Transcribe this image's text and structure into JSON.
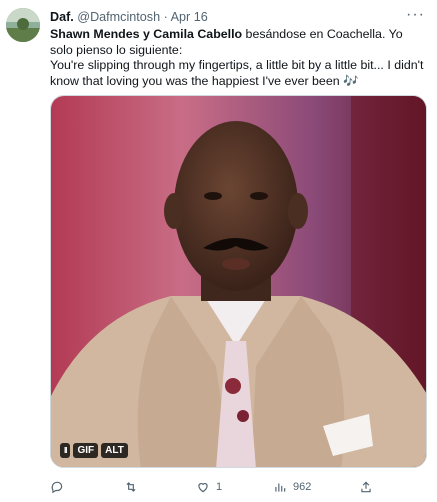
{
  "tweet": {
    "author_name": "Daf.",
    "handle": "@Dafmcintosh",
    "separator": "·",
    "date": "Apr 16",
    "more_label": "···",
    "text_bold": "Shawn Mendes y Camila Cabello",
    "text_line1_rest": " besándose en Coachella. Yo solo pienso lo siguiente:",
    "text_line2": "You're slipping through my fingertips, a little bit by a little bit... I didn't know that loving you was the happiest I've ever been",
    "text_emoji": "🎶",
    "media": {
      "pause_label": "II",
      "gif_label": "GIF",
      "alt_label": "ALT"
    },
    "actions": {
      "reply_count": "",
      "retweet_count": "",
      "like_count": "1",
      "views_count": "962"
    }
  },
  "colors": {
    "text_primary": "#0f1419",
    "text_secondary": "#536471",
    "link": "#1d9bf0",
    "border": "#cfd9de"
  }
}
